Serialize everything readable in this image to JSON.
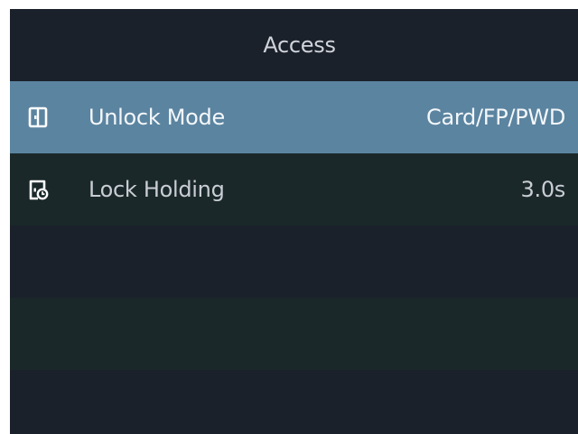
{
  "header": {
    "title": "Access"
  },
  "menu": {
    "items": [
      {
        "label": "Unlock Mode",
        "value": "Card/FP/PWD",
        "icon": "door-icon",
        "selected": true
      },
      {
        "label": "Lock Holding",
        "value": "3.0s",
        "icon": "door-timer-icon",
        "selected": false
      }
    ]
  },
  "colors": {
    "background": "#1b212b",
    "selected_row": "#5b84a0",
    "alt_row": "#1a282a",
    "text": "#d9dde2"
  }
}
